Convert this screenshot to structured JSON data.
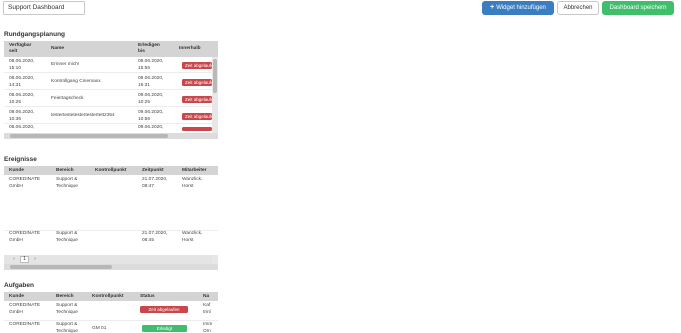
{
  "header": {
    "dashboard_name": "Support Dashboard",
    "add_widget_label": "Widget hinzufügen",
    "add_icon": "+",
    "cancel_label": "Abbrechen",
    "save_label": "Dashboard speichern"
  },
  "rundgang": {
    "title": "Rundgangsplanung",
    "columns": [
      "Verfügbar\nseit",
      "Name",
      "Erledigen\nbis",
      "Innerhalb"
    ],
    "rows": [
      {
        "since": "08.06.2020,\n15:10",
        "name": "Erinner mich!",
        "until": "08.06.2020,\n15:55",
        "status": "Zeit abgelaufen"
      },
      {
        "since": "08.06.2020,\n14:31",
        "name": "Kontrollgang Cinemaxx",
        "until": "08.06.2020,\n16:31",
        "status": "Zeit abgelaufen"
      },
      {
        "since": "08.06.2020,\n10:25",
        "name": "Feiertagscheck",
        "until": "09.06.2020,\n10:25",
        "status": "Zeit abgelaufen"
      },
      {
        "since": "08.06.2020,\n10:36",
        "name": "testertestetestertestertett2354",
        "until": "09.06.2020,\n10:56",
        "status": "Zeit abgelaufen"
      },
      {
        "since": "08.06.2020,",
        "name": "",
        "until": "09.06.2020,",
        "status": ""
      }
    ]
  },
  "ereignisse": {
    "title": "Ereignisse",
    "columns": [
      "Kunde",
      "Bereich",
      "Kontrollpunkt",
      "Zeitpunkt",
      "Mitarbeiter"
    ],
    "rows": [
      {
        "kunde": "COREDINATE\nGmbH",
        "bereich": "Support &\nTechnique",
        "kontrollpunkt": "",
        "zeitpunkt": "21.07.2020,\n08:47",
        "mitarbeiter": "Wanzlick,\nHorst"
      },
      {
        "kunde": "COREDINATE\nGmbH",
        "bereich": "Support &\nTechnique",
        "kontrollpunkt": "",
        "zeitpunkt": "21.07.2020,\n08:45",
        "mitarbeiter": "Wanzlick,\nHorst"
      }
    ],
    "pager": {
      "prev": "‹",
      "current": "1",
      "next": "›"
    }
  },
  "aufgaben": {
    "title": "Aufgaben",
    "columns": [
      "Kunde",
      "Bereich",
      "Kontrollpunkt",
      "Status",
      "Na"
    ],
    "rows": [
      {
        "kunde": "COREDINATE\nGmbH",
        "bereich": "Support &\nTechnique",
        "kontrollpunkt": "",
        "status": "Zeit abgelaufen",
        "status_color": "#c9474a",
        "na": "Kaf\ntrinl"
      },
      {
        "kunde": "COREDINATE",
        "bereich": "Support &\nTechnique",
        "kontrollpunkt": "GM 01",
        "status": "Erledigt",
        "status_color": "#3fbf6b",
        "na": "Imm\nOm"
      }
    ]
  },
  "colors": {
    "primary": "#3b7dc1",
    "success": "#3fbf6b",
    "danger": "#c9474a"
  }
}
